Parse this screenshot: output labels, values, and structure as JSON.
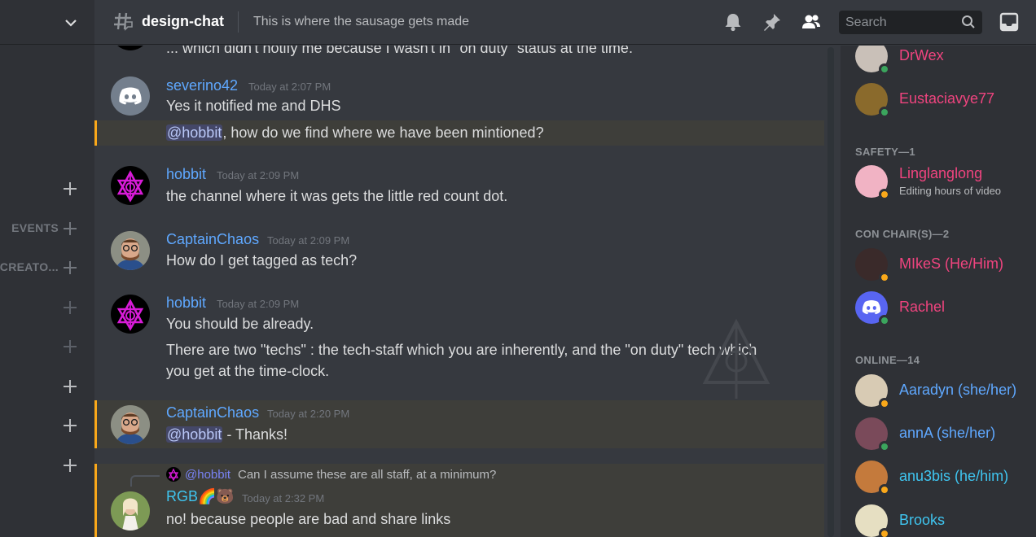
{
  "sidebar": {
    "categories": [
      {
        "label": ""
      },
      {
        "label": "EVENTS"
      },
      {
        "label": "VIDEO CREATO..."
      },
      {
        "label": ""
      },
      {
        "label": ""
      },
      {
        "label": ""
      },
      {
        "label": ""
      },
      {
        "label": ""
      }
    ]
  },
  "header": {
    "channel_name": "design-chat",
    "topic": "This is where the sausage gets made",
    "search_placeholder": "Search"
  },
  "messages": {
    "prev_tail": "... which didn't notify me because I wasn't in \"on duty\" status at the time.",
    "m1": {
      "author": "severino42",
      "timestamp": "Today at 2:07 PM",
      "line1": "Yes it notified me and DHS",
      "mention": "@hobbit",
      "line2_rest": ", how do we find where we have been mintioned?"
    },
    "m2": {
      "author": "hobbit",
      "timestamp": "Today at 2:09 PM",
      "line1": "the channel where it was gets the little red count dot."
    },
    "m3": {
      "author": "CaptainChaos",
      "timestamp": "Today at 2:09 PM",
      "line1": "How do I get tagged as tech?"
    },
    "m4": {
      "author": "hobbit",
      "timestamp": "Today at 2:09 PM",
      "line1": "You should be already.",
      "line2": "There are two \"techs\" : the tech-staff which you are inherently, and the \"on duty\" tech which",
      "line3": "you get at the time-clock."
    },
    "m5": {
      "author": "CaptainChaos",
      "timestamp": "Today at 2:20 PM",
      "mention": "@hobbit",
      "line1_rest": " - Thanks!"
    },
    "m6": {
      "reply_author": "@hobbit",
      "reply_text": "Can I assume these are all staff, at a minimum?",
      "author": "RGB🌈🐻",
      "timestamp": "Today at 2:32 PM",
      "line1": "no! because people are bad and share links"
    }
  },
  "members": {
    "top": [
      {
        "name": "DrWex",
        "status": "online"
      },
      {
        "name": "Eustaciavye77",
        "status": "online"
      }
    ],
    "safety": {
      "header": "SAFETY—1",
      "items": [
        {
          "name": "Linglanglong",
          "activity": "Editing hours of video",
          "status": "idle"
        }
      ]
    },
    "con_chairs": {
      "header": "CON CHAIR(S)—2",
      "items": [
        {
          "name": "MIkeS (He/Him)",
          "status": "idle"
        },
        {
          "name": "Rachel",
          "status": "online"
        }
      ]
    },
    "online": {
      "header": "ONLINE—14",
      "items": [
        {
          "name": "Aaradyn (she/her)",
          "status": "idle"
        },
        {
          "name": "annA (she/her)",
          "status": "online"
        },
        {
          "name": "anu3bis (he/him)",
          "status": "idle"
        },
        {
          "name": "Brooks",
          "status": "idle"
        }
      ]
    }
  },
  "colors": {
    "link_blue": "#5fa8ff",
    "pink": "#f0447f",
    "cyan": "#3fc5f0",
    "online": "#3ba55d",
    "idle": "#faa81a",
    "highlight_bar": "#faa81a"
  }
}
